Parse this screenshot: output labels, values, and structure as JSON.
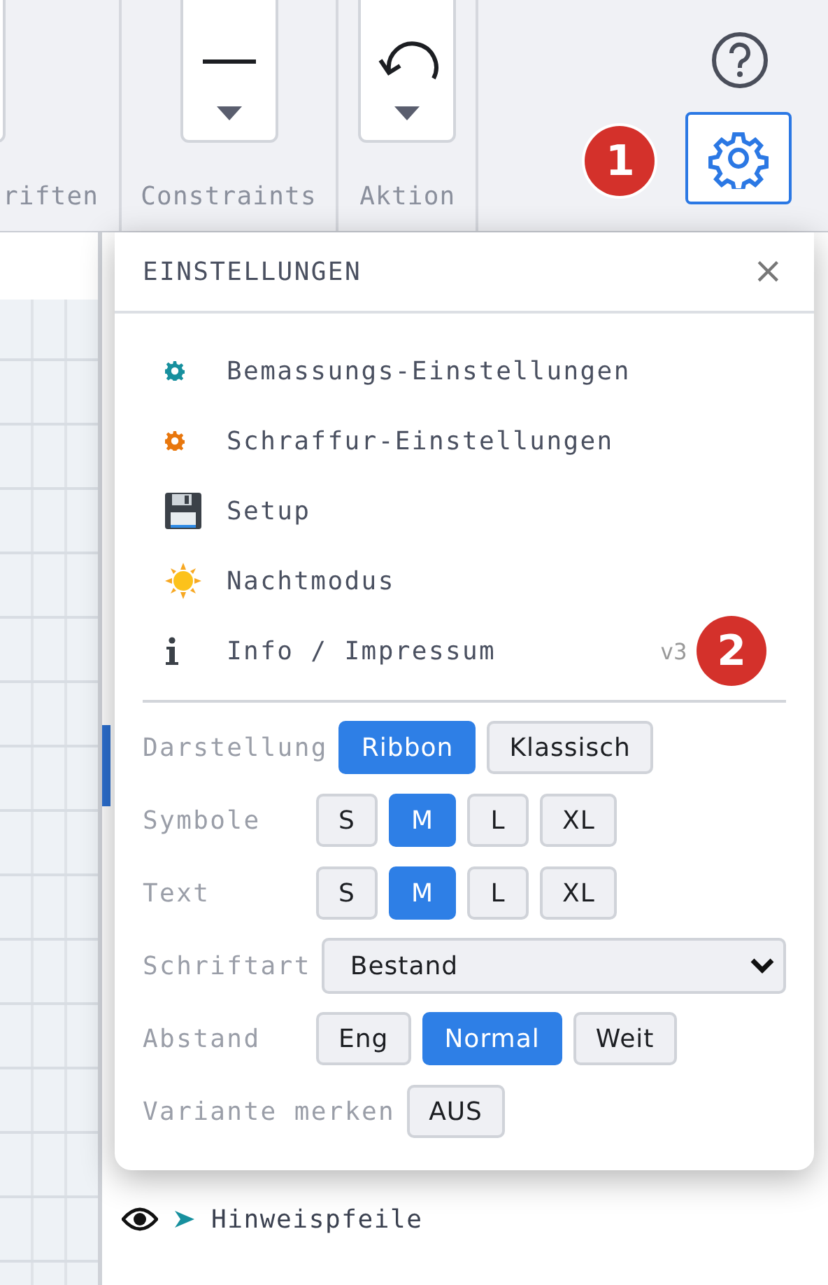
{
  "toolbar": {
    "groups": [
      {
        "label": "riften",
        "kind": "partial"
      },
      {
        "label": "Constraints",
        "kind": "line"
      },
      {
        "label": "Aktion",
        "kind": "undo"
      }
    ]
  },
  "badges": [
    "1",
    "2"
  ],
  "panel": {
    "title": "EINSTELLUNGEN",
    "close": "×",
    "menu": [
      {
        "label": "Bemassungs-Einstellungen",
        "kind": "dimension"
      },
      {
        "label": "Schraffur-Einstellungen",
        "kind": "hatch"
      },
      {
        "label": "Setup",
        "kind": "save"
      },
      {
        "label": "Nachtmodus",
        "kind": "theme"
      },
      {
        "label": "Info / Impressum",
        "kind": "info",
        "version": "v3"
      }
    ],
    "options": [
      {
        "label": "Darstellung",
        "kind": "buttons",
        "choices": [
          {
            "label": "Ribbon",
            "selected": true
          },
          {
            "label": "Klassisch",
            "selected": false
          }
        ]
      },
      {
        "label": "Symbole",
        "kind": "buttons",
        "choices": [
          {
            "label": "S",
            "selected": false
          },
          {
            "label": "M",
            "selected": true
          },
          {
            "label": "L",
            "selected": false
          },
          {
            "label": "XL",
            "selected": false
          }
        ]
      },
      {
        "label": "Text",
        "kind": "buttons",
        "choices": [
          {
            "label": "S",
            "selected": false
          },
          {
            "label": "M",
            "selected": true
          },
          {
            "label": "L",
            "selected": false
          },
          {
            "label": "XL",
            "selected": false
          }
        ]
      },
      {
        "label": "Schriftart",
        "kind": "select",
        "value": "Bestand"
      },
      {
        "label": "Abstand",
        "kind": "buttons",
        "choices": [
          {
            "label": "Eng",
            "selected": false
          },
          {
            "label": "Normal",
            "selected": true
          },
          {
            "label": "Weit",
            "selected": false
          }
        ]
      },
      {
        "label": "Variante merken",
        "kind": "buttons",
        "choices": [
          {
            "label": "AUS",
            "selected": false
          }
        ]
      }
    ]
  },
  "layers": [
    {
      "label": "Hinweispfeile",
      "visible": true
    }
  ]
}
